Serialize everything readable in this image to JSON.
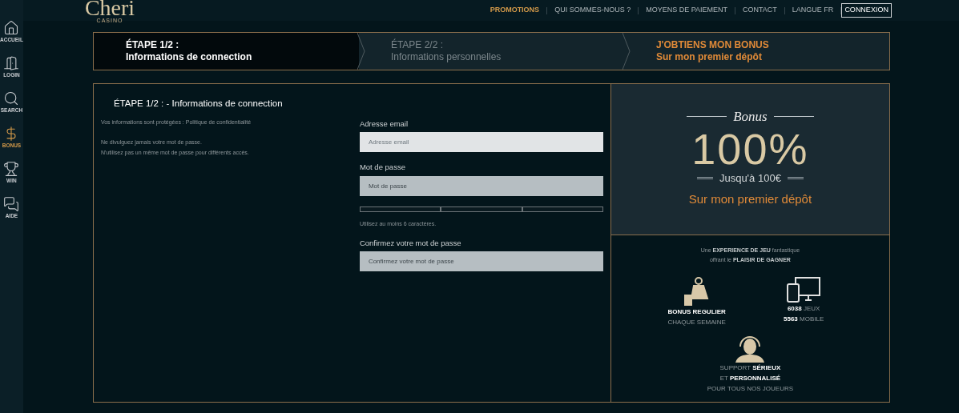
{
  "logo": {
    "name": "Cheri",
    "tagline": "CASINO"
  },
  "nav": [
    {
      "label": "PROMOTIONS",
      "selected": true
    },
    {
      "label": "QUI SOMMES-NOUS ?",
      "selected": false
    },
    {
      "label": "MOYENS DE PAIEMENT",
      "selected": false
    },
    {
      "label": "CONTACT",
      "selected": false
    },
    {
      "label": "LANGUE FR",
      "selected": false
    }
  ],
  "login_button": "CONNEXION",
  "sidebar": [
    {
      "kind": "home",
      "label": "ACCUEIL",
      "selected": false
    },
    {
      "kind": "login",
      "label": "LOGIN",
      "selected": false
    },
    {
      "kind": "search",
      "label": "SEARCH",
      "selected": false
    },
    {
      "kind": "bonus",
      "label": "BONUS",
      "selected": true
    },
    {
      "kind": "win",
      "label": "WIN",
      "selected": false
    },
    {
      "kind": "help",
      "label": "AIDE",
      "selected": false
    }
  ],
  "steps": [
    {
      "kind": "step",
      "title": "ÉTAPE 1/2 :",
      "subtitle": "Informations de connection",
      "selected": true
    },
    {
      "kind": "step",
      "title": "ÉTAPE 2/2 :",
      "subtitle": "Informations personnelles",
      "selected": false
    },
    {
      "kind": "bonus",
      "title": "J'OBTIENS MON BONUS",
      "subtitle": "Sur mon premier dépôt",
      "selected": false
    }
  ],
  "form": {
    "heading": "ÉTAPE 1/2 : - Informations de connection",
    "notes": [
      "Vos informations sont protégées : Politique de confidentialité",
      "Ne divulguez jamais votre mot de passe.",
      "N'utilisez pas un même mot de passe pour différents accès."
    ],
    "fields": [
      {
        "label": "Adresse email",
        "placeholder": "Adresse email",
        "focused": true
      },
      {
        "label": "Mot de passe",
        "placeholder": "Mot de passe",
        "focused": false,
        "strength": [
          {
            "filled": false
          },
          {
            "filled": false
          },
          {
            "filled": false
          }
        ],
        "hint": "Utilisez au moins 6 caractères."
      },
      {
        "label": "Confirmez votre mot de passe",
        "placeholder": "Confirmez votre mot de passe",
        "focused": false
      }
    ]
  },
  "bonus": {
    "script": "Bonus",
    "amount": "100%",
    "limit": "Jusqu'à 100€",
    "caption": "Sur mon premier dépôt"
  },
  "experience": {
    "lines": [
      "Une **EXPERIENCE DE JEU** fantastique",
      "offrant le **PLAISIR DE GAGNER**"
    ],
    "features": [
      {
        "kind": "bag",
        "lines": [
          "**BONUS REGULIER**",
          "CHAQUE SEMAINE"
        ]
      },
      {
        "kind": "devices",
        "lines": [
          "**6038** JEUX",
          "**5563** MOBILE"
        ]
      },
      {
        "kind": "headset",
        "lines": [
          "SUPPORT **SÉRIEUX**",
          "ET **PERSONNALISÉ**",
          "POUR TOUS NOS JOUEURS"
        ]
      }
    ]
  }
}
